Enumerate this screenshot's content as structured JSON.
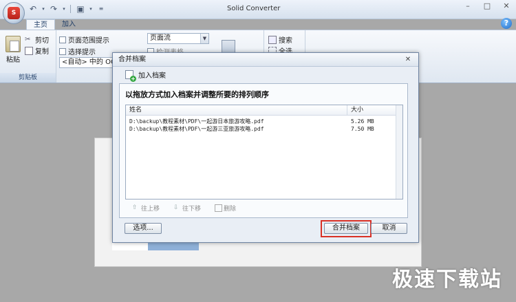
{
  "window": {
    "title": "Solid Converter",
    "controls": [
      "–",
      "□",
      "✕"
    ]
  },
  "ribbon_tabs": [
    {
      "label": "主页",
      "active": true
    },
    {
      "label": "加入",
      "active": false
    }
  ],
  "clipboard_group": {
    "paste": "粘贴",
    "cut": "剪切",
    "copy": "复制",
    "label": "剪贴板"
  },
  "options_group": {
    "page_range_hint": "页面范围提示",
    "selection_hint": "选择提示",
    "ocr_combo": "<自动> 中的 OCR",
    "page_flow_combo": "页面流",
    "partial_label": "检测表格",
    "search": "搜索",
    "all": "全选"
  },
  "dialog": {
    "title": "合并档案",
    "add_files": "加入档案",
    "heading": "以拖放方式加入档案并调整所要的排列顺序",
    "columns": {
      "name": "姓名",
      "size": "大小"
    },
    "rows": [
      {
        "name": "D:\\backup\\教程素材\\PDF\\一起游日本旅游攻略.pdf",
        "size": "5.26 MB"
      },
      {
        "name": "D:\\backup\\教程素材\\PDF\\一起游三亚旅游攻略.pdf",
        "size": "7.50 MB"
      }
    ],
    "move_up": "往上移",
    "move_down": "往下移",
    "delete": "删除",
    "options_button": "选项...",
    "merge_button": "合并档案",
    "cancel_button": "取消"
  },
  "watermark": "极速下载站"
}
